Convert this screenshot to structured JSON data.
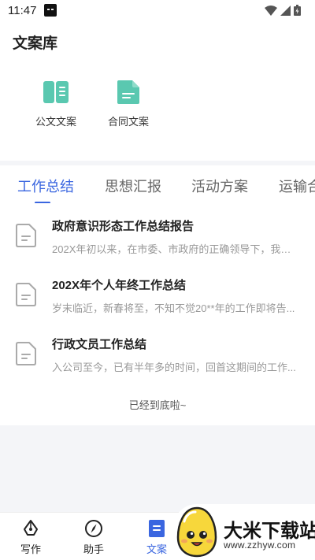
{
  "status_bar": {
    "time": "11:47"
  },
  "header": {
    "title": "文案库"
  },
  "categories": [
    {
      "label": "公文文案",
      "icon": "book-icon",
      "color": "#5ac8b0"
    },
    {
      "label": "合同文案",
      "icon": "document-icon",
      "color": "#5ac8b0"
    }
  ],
  "tabs": [
    {
      "label": "工作总结",
      "active": true
    },
    {
      "label": "思想汇报"
    },
    {
      "label": "活动方案"
    },
    {
      "label": "运输合"
    }
  ],
  "documents": [
    {
      "title": "政府意识形态工作总结报告",
      "desc": "202X年初以来，在市委、市政府的正确领导下，我院..."
    },
    {
      "title": "202X年个人年终工作总结",
      "desc": "岁末临近，新春将至，不知不觉20**年的工作即将告..."
    },
    {
      "title": "行政文员工作总结",
      "desc": "入公司至今，已有半年多的时间，回首这期间的工作..."
    }
  ],
  "list_end": "已经到底啦~",
  "bottom_nav": [
    {
      "label": "写作",
      "icon": "pen-icon"
    },
    {
      "label": "助手",
      "icon": "compass-icon"
    },
    {
      "label": "文案",
      "icon": "document-icon",
      "active": true
    }
  ],
  "watermark": {
    "text": "大米下载站",
    "url": "www.zzhyw.com"
  },
  "colors": {
    "accent": "#3a66e0",
    "teal": "#5ac8b0"
  }
}
